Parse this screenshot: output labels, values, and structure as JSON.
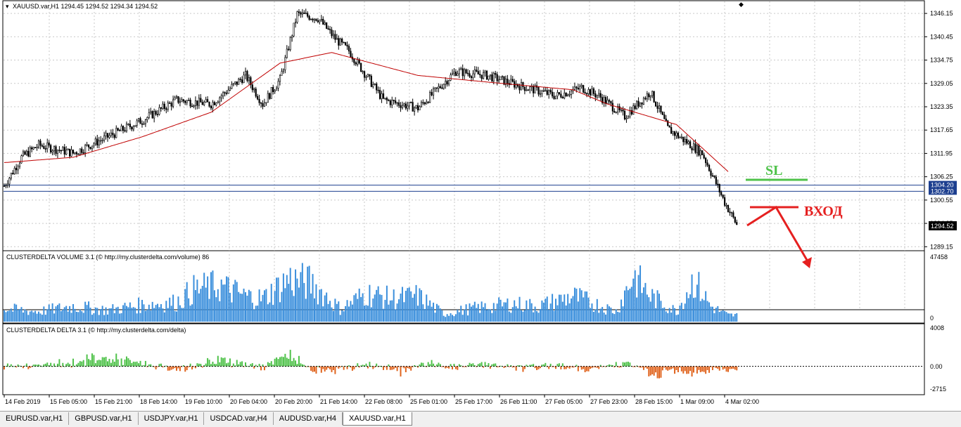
{
  "window": {
    "title": "XAUUSD.var,H1  1294.45 1294.52 1294.34 1294.52"
  },
  "price_panel": {
    "y_ticks": [
      "1346.15",
      "1340.45",
      "1334.75",
      "1329.05",
      "1323.35",
      "1317.65",
      "1311.95",
      "1306.25",
      "1300.55",
      "1294.85",
      "1289.15"
    ],
    "hlines": [
      {
        "label": "1304.20",
        "color": "#1d3f8f"
      },
      {
        "label": "1302.70",
        "color": "#1d3f8f"
      }
    ],
    "current_price_label": "1294.52",
    "annotations": {
      "sl": "SL",
      "entry": "ВХОД"
    },
    "ma_color": "#c00000"
  },
  "volume_panel": {
    "title": "CLUSTERDELTA VOLUME 3.1 (© http://my.clusterdelta.com/volume) 86",
    "max_label": "47458",
    "zero_label": "0",
    "color": "#3b8fdc"
  },
  "delta_panel": {
    "title": "CLUSTERDELTA DELTA 3.1 (© http://my.clusterdelta.com/delta)",
    "top_label": "4008",
    "zero_label": "0.00",
    "bottom_label": "-2715",
    "pos_color": "#4fc24a",
    "neg_color": "#e0641e"
  },
  "time_axis": {
    "labels": [
      "14 Feb 2019",
      "15 Feb 05:00",
      "15 Feb 21:00",
      "18 Feb 14:00",
      "19 Feb 10:00",
      "20 Feb 04:00",
      "20 Feb 20:00",
      "21 Feb 14:00",
      "22 Feb 08:00",
      "25 Feb 01:00",
      "25 Feb 17:00",
      "26 Feb 11:00",
      "27 Feb 05:00",
      "27 Feb 23:00",
      "28 Feb 15:00",
      "1 Mar 09:00",
      "4 Mar 02:00"
    ]
  },
  "tabs": [
    {
      "label": "EURUSD.var,H1",
      "active": false
    },
    {
      "label": "GBPUSD.var,H1",
      "active": false
    },
    {
      "label": "USDJPY.var,H1",
      "active": false
    },
    {
      "label": "USDCAD.var,H4",
      "active": false
    },
    {
      "label": "AUDUSD.var,H4",
      "active": false
    },
    {
      "label": "XAUUSD.var,H1",
      "active": true
    }
  ],
  "chart_data": {
    "type": "line",
    "title": "XAUUSD.var,H1",
    "anchors_price": [
      [
        0,
        1304
      ],
      [
        10,
        1311
      ],
      [
        20,
        1314
      ],
      [
        40,
        1312
      ],
      [
        60,
        1316
      ],
      [
        80,
        1320
      ],
      [
        100,
        1325
      ],
      [
        120,
        1324
      ],
      [
        140,
        1331
      ],
      [
        150,
        1324
      ],
      [
        160,
        1330
      ],
      [
        170,
        1346
      ],
      [
        182,
        1345
      ],
      [
        192,
        1340
      ],
      [
        200,
        1337
      ],
      [
        220,
        1325
      ],
      [
        240,
        1323
      ],
      [
        262,
        1332
      ],
      [
        280,
        1331
      ],
      [
        295,
        1329
      ],
      [
        320,
        1326
      ],
      [
        335,
        1328
      ],
      [
        345,
        1326
      ],
      [
        360,
        1321
      ],
      [
        375,
        1327
      ],
      [
        385,
        1318
      ],
      [
        405,
        1312
      ],
      [
        418,
        1300
      ],
      [
        425,
        1294.52
      ]
    ],
    "anchors_ma": [
      [
        0,
        1309.7
      ],
      [
        40,
        1311
      ],
      [
        80,
        1316
      ],
      [
        120,
        1322
      ],
      [
        160,
        1334
      ],
      [
        190,
        1336.6
      ],
      [
        240,
        1331
      ],
      [
        290,
        1329
      ],
      [
        330,
        1327.5
      ],
      [
        350,
        1324
      ],
      [
        390,
        1319
      ],
      [
        420,
        1307.5
      ]
    ],
    "volume_anchors": [
      [
        0,
        10000
      ],
      [
        20,
        8000
      ],
      [
        40,
        12000
      ],
      [
        60,
        9000
      ],
      [
        80,
        13000
      ],
      [
        100,
        15000
      ],
      [
        110,
        25000
      ],
      [
        125,
        28000
      ],
      [
        140,
        20000
      ],
      [
        150,
        18000
      ],
      [
        165,
        33000
      ],
      [
        178,
        30000
      ],
      [
        195,
        10000
      ],
      [
        210,
        22000
      ],
      [
        225,
        18000
      ],
      [
        240,
        20000
      ],
      [
        255,
        6000
      ],
      [
        270,
        10000
      ],
      [
        295,
        14000
      ],
      [
        310,
        12000
      ],
      [
        330,
        20000
      ],
      [
        355,
        8000
      ],
      [
        365,
        36000
      ],
      [
        375,
        20000
      ],
      [
        390,
        8000
      ],
      [
        400,
        33000
      ],
      [
        410,
        12000
      ],
      [
        420,
        5000
      ]
    ],
    "delta_anchors": [
      [
        0,
        0
      ],
      [
        40,
        400
      ],
      [
        55,
        900
      ],
      [
        80,
        300
      ],
      [
        100,
        -400
      ],
      [
        125,
        700
      ],
      [
        150,
        -200
      ],
      [
        165,
        1300
      ],
      [
        180,
        -600
      ],
      [
        195,
        -400
      ],
      [
        210,
        200
      ],
      [
        230,
        -500
      ],
      [
        245,
        300
      ],
      [
        262,
        -100
      ],
      [
        280,
        250
      ],
      [
        300,
        -300
      ],
      [
        320,
        150
      ],
      [
        340,
        -400
      ],
      [
        360,
        500
      ],
      [
        375,
        -800
      ],
      [
        390,
        -600
      ],
      [
        405,
        -400
      ],
      [
        420,
        -300
      ]
    ],
    "y_range": [
      1288.0,
      1348.4
    ],
    "volume_range": [
      0,
      47458
    ],
    "delta_range": [
      -2715,
      4008
    ]
  }
}
